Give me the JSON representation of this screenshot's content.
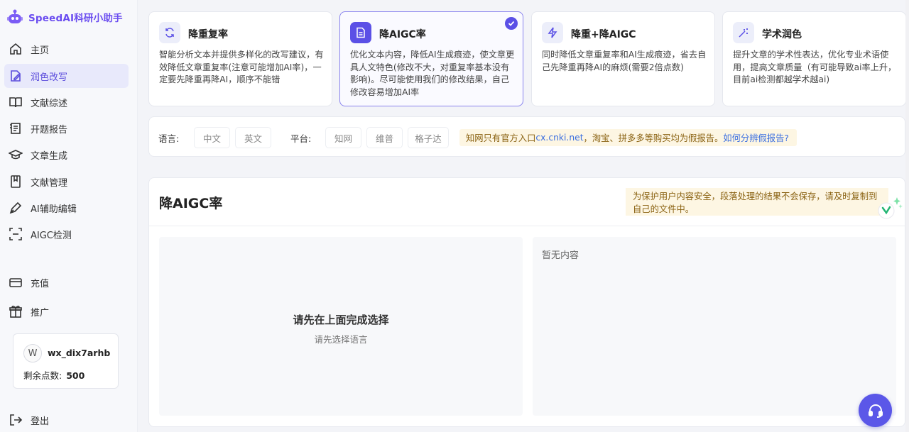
{
  "app": {
    "title": "SpeedAI科研小助手"
  },
  "sidebar": {
    "items": [
      {
        "label": "主页",
        "icon": "home-icon"
      },
      {
        "label": "润色改写",
        "icon": "edit-icon",
        "active": true
      },
      {
        "label": "文献综述",
        "icon": "book-icon"
      },
      {
        "label": "开题报告",
        "icon": "report-icon"
      },
      {
        "label": "文章生成",
        "icon": "graduation-cap-icon"
      },
      {
        "label": "文献管理",
        "icon": "bookmark-icon"
      },
      {
        "label": "AI辅助编辑",
        "icon": "pen-icon"
      },
      {
        "label": "AIGC检测",
        "icon": "scan-icon"
      },
      {
        "label": "充值",
        "icon": "card-icon"
      },
      {
        "label": "推广",
        "icon": "gift-icon"
      },
      {
        "label": "登出",
        "icon": "logout-icon"
      }
    ]
  },
  "user": {
    "avatar": "W",
    "name": "wx_dix7arhb",
    "points_label": "剩余点数:",
    "points": "500"
  },
  "modes": [
    {
      "title": "降重复率",
      "desc": "智能分析文本并提供多样化的改写建议，有效降低文章重复率(注意可能增加AI率)，一定要先降重再降AI，顺序不能错",
      "icon": "refresh-icon"
    },
    {
      "title": "降AIGC率",
      "desc": "优化文本内容，降低AI生成痕迹，使文章更具人文特色(修改不大，对重复率基本没有影响)。尽可能使用我们的修改结果，自己修改容易增加AI率",
      "icon": "document-icon",
      "selected": true
    },
    {
      "title": "降重+降AIGC",
      "desc": "同时降低文章重复率和AI生成痕迹，省去自己先降重再降AI的麻烦(需要2倍点数)",
      "icon": "lightning-icon"
    },
    {
      "title": "学术润色",
      "desc": "提升文章的学术性表达，优化专业术语使用，提高文章质量（有可能导致ai率上升，目前ai检测都越学术越ai)",
      "icon": "magic-wand-icon"
    }
  ],
  "filters": {
    "language_label": "语言:",
    "languages": [
      "中文",
      "英文"
    ],
    "platform_label": "平台:",
    "platforms": [
      "知网",
      "维普",
      "格子达"
    ],
    "notice_prefix": "知网只有官方入口 ",
    "notice_link1": "cx.cnki.net",
    "notice_middle": "，淘宝、拼多多等购买均为假报告。",
    "notice_link2": "如何分辨假报告?"
  },
  "panel": {
    "title": "降AIGC率",
    "warning": "为保护用户内容安全，段落处理的结果不会保存，请及时复制到自己的文件中。",
    "left_title": "请先在上面完成选择",
    "left_subtitle": "请先选择语言",
    "right_placeholder": "暂无内容"
  },
  "colors": {
    "accent": "#5b50e6",
    "brand": "#6a4cf0",
    "notice_bg": "#fdf6e3"
  }
}
